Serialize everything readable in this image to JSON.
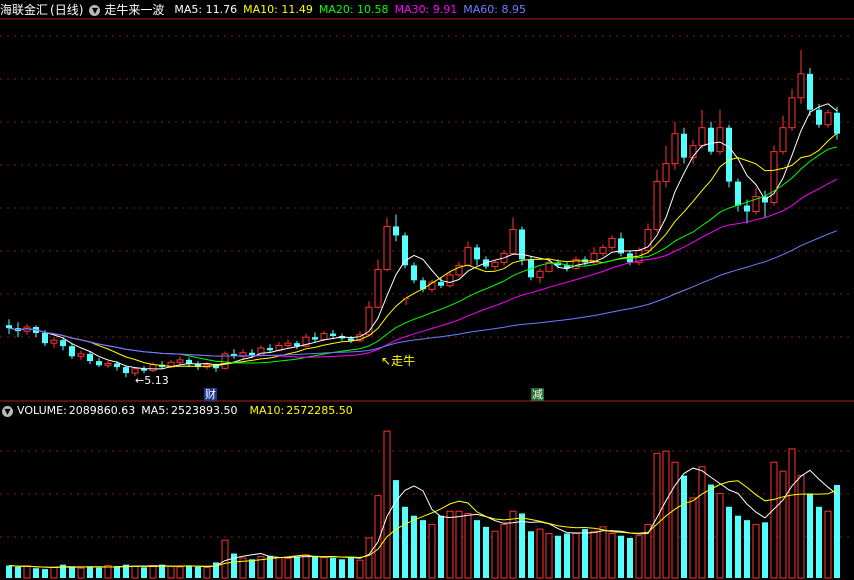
{
  "header": {
    "stock_name": "海联金汇",
    "period": "(日线)",
    "indicator_name": "走牛来一波",
    "ma_items": [
      {
        "label": "MA5:",
        "value": "11.76",
        "color": "#ffffff"
      },
      {
        "label": "MA10:",
        "value": "11.49",
        "color": "#ffff00"
      },
      {
        "label": "MA20:",
        "value": "10.58",
        "color": "#00ff00"
      },
      {
        "label": "MA30:",
        "value": "9.91",
        "color": "#ff00ff"
      },
      {
        "label": "MA60:",
        "value": "8.95",
        "color": "#6f7dff"
      }
    ]
  },
  "volume_header": {
    "label": "VOLUME:",
    "value": "2089860.63",
    "ma5_label": "MA5:",
    "ma5_value": "2523893.50",
    "ma10_label": "MA10:",
    "ma10_value": "2572285.50"
  },
  "annotations": {
    "low_label": "5.13",
    "signal_label": "走牛",
    "t_mark": "T",
    "event_cai": "财",
    "event_jian": "减"
  },
  "colors": {
    "up": "#ff3232",
    "down": "#54ffff",
    "grid": "#841e1e",
    "ma5": "#ffffff",
    "ma10": "#ffff00",
    "ma20": "#00ff00",
    "ma30": "#ff00ff",
    "ma60": "#6f7dff"
  },
  "chart_data": {
    "type": "candlestick",
    "candles": [
      [
        6.0,
        5.95,
        6.1,
        5.85
      ],
      [
        5.95,
        5.9,
        6.05,
        5.8
      ],
      [
        5.9,
        5.97,
        6.02,
        5.84
      ],
      [
        5.97,
        5.87,
        6.0,
        5.8
      ],
      [
        5.87,
        5.7,
        5.92,
        5.65
      ],
      [
        5.7,
        5.75,
        5.8,
        5.62
      ],
      [
        5.75,
        5.65,
        5.78,
        5.58
      ],
      [
        5.65,
        5.48,
        5.7,
        5.44
      ],
      [
        5.48,
        5.52,
        5.58,
        5.42
      ],
      [
        5.52,
        5.4,
        5.56,
        5.35
      ],
      [
        5.4,
        5.33,
        5.45,
        5.3
      ],
      [
        5.33,
        5.36,
        5.4,
        5.28
      ],
      [
        5.36,
        5.3,
        5.4,
        5.24
      ],
      [
        5.3,
        5.2,
        5.32,
        5.13
      ],
      [
        5.2,
        5.27,
        5.3,
        5.15
      ],
      [
        5.27,
        5.24,
        5.32,
        5.2
      ],
      [
        5.24,
        5.34,
        5.38,
        5.22
      ],
      [
        5.34,
        5.3,
        5.4,
        5.26
      ],
      [
        5.3,
        5.38,
        5.42,
        5.28
      ],
      [
        5.38,
        5.42,
        5.48,
        5.34
      ],
      [
        5.42,
        5.36,
        5.46,
        5.3
      ],
      [
        5.36,
        5.3,
        5.4,
        5.25
      ],
      [
        5.3,
        5.34,
        5.38,
        5.26
      ],
      [
        5.34,
        5.28,
        5.36,
        5.22
      ],
      [
        5.28,
        5.52,
        5.56,
        5.26
      ],
      [
        5.52,
        5.48,
        5.6,
        5.44
      ],
      [
        5.48,
        5.54,
        5.6,
        5.44
      ],
      [
        5.54,
        5.5,
        5.6,
        5.46
      ],
      [
        5.5,
        5.62,
        5.66,
        5.48
      ],
      [
        5.62,
        5.58,
        5.68,
        5.54
      ],
      [
        5.58,
        5.66,
        5.72,
        5.56
      ],
      [
        5.66,
        5.7,
        5.76,
        5.62
      ],
      [
        5.7,
        5.65,
        5.74,
        5.6
      ],
      [
        5.65,
        5.8,
        5.86,
        5.63
      ],
      [
        5.8,
        5.76,
        5.88,
        5.72
      ],
      [
        5.76,
        5.86,
        5.9,
        5.74
      ],
      [
        5.86,
        5.82,
        5.92,
        5.78
      ],
      [
        5.82,
        5.78,
        5.86,
        5.74
      ],
      [
        5.78,
        5.74,
        5.82,
        5.7
      ],
      [
        5.74,
        5.84,
        5.9,
        5.72
      ],
      [
        5.84,
        6.3,
        6.4,
        5.82
      ],
      [
        6.3,
        6.93,
        7.1,
        6.28
      ],
      [
        6.93,
        7.65,
        7.8,
        6.9
      ],
      [
        7.65,
        7.5,
        7.85,
        7.4
      ],
      [
        7.5,
        7.0,
        7.55,
        6.95
      ],
      [
        7.0,
        6.75,
        7.05,
        6.7
      ],
      [
        6.75,
        6.6,
        6.8,
        6.55
      ],
      [
        6.6,
        6.72,
        6.76,
        6.55
      ],
      [
        6.72,
        6.66,
        6.8,
        6.62
      ],
      [
        6.66,
        6.84,
        6.9,
        6.63
      ],
      [
        6.84,
        7.0,
        7.06,
        6.8
      ],
      [
        7.0,
        7.3,
        7.4,
        6.98
      ],
      [
        7.3,
        7.1,
        7.35,
        7.0
      ],
      [
        7.1,
        6.98,
        7.15,
        6.94
      ],
      [
        6.98,
        7.05,
        7.1,
        6.92
      ],
      [
        7.05,
        7.2,
        7.25,
        7.0
      ],
      [
        7.2,
        7.6,
        7.8,
        7.18
      ],
      [
        7.6,
        7.1,
        7.65,
        7.0
      ],
      [
        7.1,
        6.8,
        7.15,
        6.75
      ],
      [
        6.8,
        6.9,
        6.95,
        6.7
      ],
      [
        6.9,
        7.05,
        7.1,
        6.88
      ],
      [
        7.05,
        7.0,
        7.1,
        6.95
      ],
      [
        7.0,
        6.95,
        7.05,
        6.9
      ],
      [
        6.95,
        7.1,
        7.15,
        6.92
      ],
      [
        7.1,
        7.05,
        7.15,
        7.0
      ],
      [
        7.05,
        7.2,
        7.3,
        7.02
      ],
      [
        7.2,
        7.3,
        7.35,
        7.15
      ],
      [
        7.3,
        7.45,
        7.5,
        7.25
      ],
      [
        7.45,
        7.2,
        7.55,
        7.15
      ],
      [
        7.2,
        7.05,
        7.25,
        7.0
      ],
      [
        7.05,
        7.25,
        7.3,
        7.0
      ],
      [
        7.25,
        7.6,
        7.7,
        7.2
      ],
      [
        7.6,
        8.4,
        8.6,
        7.55
      ],
      [
        8.4,
        8.7,
        9.0,
        8.3
      ],
      [
        8.7,
        9.2,
        9.4,
        8.6
      ],
      [
        9.2,
        8.8,
        9.3,
        8.7
      ],
      [
        8.8,
        9.0,
        9.1,
        8.7
      ],
      [
        9.0,
        9.3,
        9.6,
        8.95
      ],
      [
        9.3,
        8.9,
        9.4,
        8.85
      ],
      [
        8.9,
        9.3,
        9.6,
        8.85
      ],
      [
        9.3,
        8.4,
        9.35,
        8.3
      ],
      [
        8.4,
        8.0,
        8.45,
        7.9
      ],
      [
        8.0,
        7.9,
        8.1,
        7.7
      ],
      [
        7.9,
        8.15,
        8.3,
        7.85
      ],
      [
        8.15,
        8.05,
        8.25,
        7.8
      ],
      [
        8.05,
        8.9,
        9.0,
        8.0
      ],
      [
        8.9,
        9.3,
        9.5,
        8.85
      ],
      [
        9.3,
        9.8,
        9.95,
        9.25
      ],
      [
        9.8,
        10.2,
        10.6,
        9.7
      ],
      [
        10.2,
        9.6,
        10.3,
        9.5
      ],
      [
        9.6,
        9.35,
        9.7,
        9.3
      ],
      [
        9.35,
        9.55,
        9.6,
        9.3
      ],
      [
        9.55,
        9.2,
        9.65,
        9.1
      ]
    ],
    "volumes": [
      0.28,
      0.25,
      0.27,
      0.22,
      0.2,
      0.24,
      0.3,
      0.26,
      0.22,
      0.25,
      0.23,
      0.28,
      0.27,
      0.3,
      0.26,
      0.24,
      0.28,
      0.3,
      0.26,
      0.25,
      0.27,
      0.25,
      0.24,
      0.35,
      0.85,
      0.55,
      0.45,
      0.42,
      0.48,
      0.5,
      0.46,
      0.44,
      0.48,
      0.52,
      0.5,
      0.46,
      0.45,
      0.42,
      0.48,
      0.4,
      0.9,
      1.85,
      3.3,
      2.2,
      1.6,
      1.4,
      1.3,
      1.2,
      1.4,
      1.5,
      1.5,
      1.45,
      1.3,
      1.15,
      1.05,
      1.2,
      1.5,
      1.45,
      1.05,
      1.1,
      1.0,
      0.95,
      1.0,
      1.0,
      1.1,
      1.05,
      1.15,
      1.0,
      0.95,
      0.9,
      0.95,
      1.2,
      2.8,
      2.85,
      2.6,
      2.3,
      1.8,
      2.5,
      2.1,
      1.9,
      1.6,
      1.4,
      1.3,
      1.2,
      1.25,
      2.6,
      2.4,
      2.9,
      2.3,
      1.9,
      1.6,
      1.5,
      2.09
    ],
    "price_ylim": [
      4.75,
      11.1
    ],
    "volume_ylim": [
      0,
      3.55
    ],
    "volume_unit": "million",
    "grid": true
  }
}
